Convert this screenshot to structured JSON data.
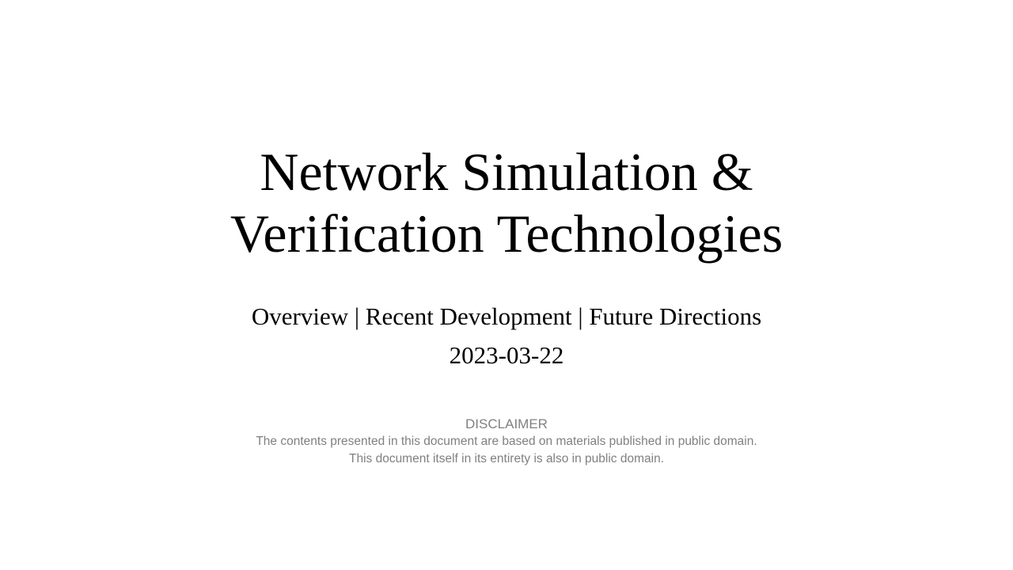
{
  "slide": {
    "title_lines": [
      "Network Simulation &",
      "Verification Technologies"
    ],
    "subtitle": "Overview | Recent Development | Future Directions",
    "date": "2023-03-22",
    "disclaimer": {
      "heading": "DISCLAIMER",
      "lines": [
        "The contents presented in this document are based on materials published in public domain.",
        "This document itself in its entirety is also in public domain."
      ]
    }
  }
}
